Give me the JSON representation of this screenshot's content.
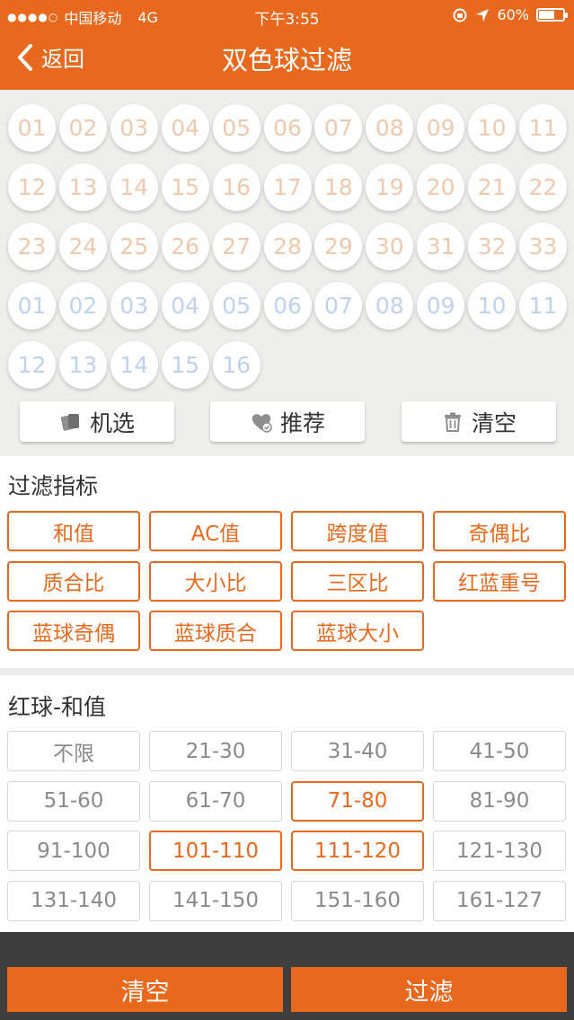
{
  "status_bar": {
    "signal": "●●●●○",
    "carrier": "中国移动",
    "network": "4G",
    "time": "下午3:55",
    "battery": "60%",
    "battery_level": 0.6
  },
  "header": {
    "back_label": "返回",
    "title": "双色球过滤"
  },
  "red_balls": [
    "01",
    "02",
    "03",
    "04",
    "05",
    "06",
    "07",
    "08",
    "09",
    "10",
    "11",
    "12",
    "13",
    "14",
    "15",
    "16",
    "17",
    "18",
    "19",
    "20",
    "21",
    "22",
    "23",
    "24",
    "25",
    "26",
    "27",
    "28",
    "29",
    "30",
    "31",
    "32",
    "33"
  ],
  "blue_balls": [
    "01",
    "02",
    "03",
    "04",
    "05",
    "06",
    "07",
    "08",
    "09",
    "10",
    "11",
    "12",
    "13",
    "14",
    "15",
    "16"
  ],
  "actions": {
    "random_label": "机选",
    "recommend_label": "推荐",
    "clear_label": "清空"
  },
  "filter_section": {
    "title": "过滤指标",
    "items": [
      "和值",
      "AC值",
      "跨度值",
      "奇偶比",
      "质合比",
      "大小比",
      "三区比",
      "红蓝重号",
      "蓝球奇偶",
      "蓝球质合",
      "蓝球大小"
    ]
  },
  "sum_section": {
    "title": "红球-和值",
    "ranges": [
      {
        "label": "不限",
        "selected": false
      },
      {
        "label": "21-30",
        "selected": false
      },
      {
        "label": "31-40",
        "selected": false
      },
      {
        "label": "41-50",
        "selected": false
      },
      {
        "label": "51-60",
        "selected": false
      },
      {
        "label": "61-70",
        "selected": false
      },
      {
        "label": "71-80",
        "selected": true
      },
      {
        "label": "81-90",
        "selected": false
      },
      {
        "label": "91-100",
        "selected": false
      },
      {
        "label": "101-110",
        "selected": true
      },
      {
        "label": "111-120",
        "selected": true
      },
      {
        "label": "121-130",
        "selected": false
      },
      {
        "label": "131-140",
        "selected": false
      },
      {
        "label": "141-150",
        "selected": false
      },
      {
        "label": "151-160",
        "selected": false
      },
      {
        "label": "161-127",
        "selected": false
      }
    ]
  },
  "bottom": {
    "clear_label": "清空",
    "filter_label": "过滤"
  },
  "colors": {
    "accent": "#E8691E",
    "red_ball_text": "#EFC9AE",
    "blue_ball_text": "#BED2F0",
    "bottom_bar": "#3E3E3E"
  }
}
